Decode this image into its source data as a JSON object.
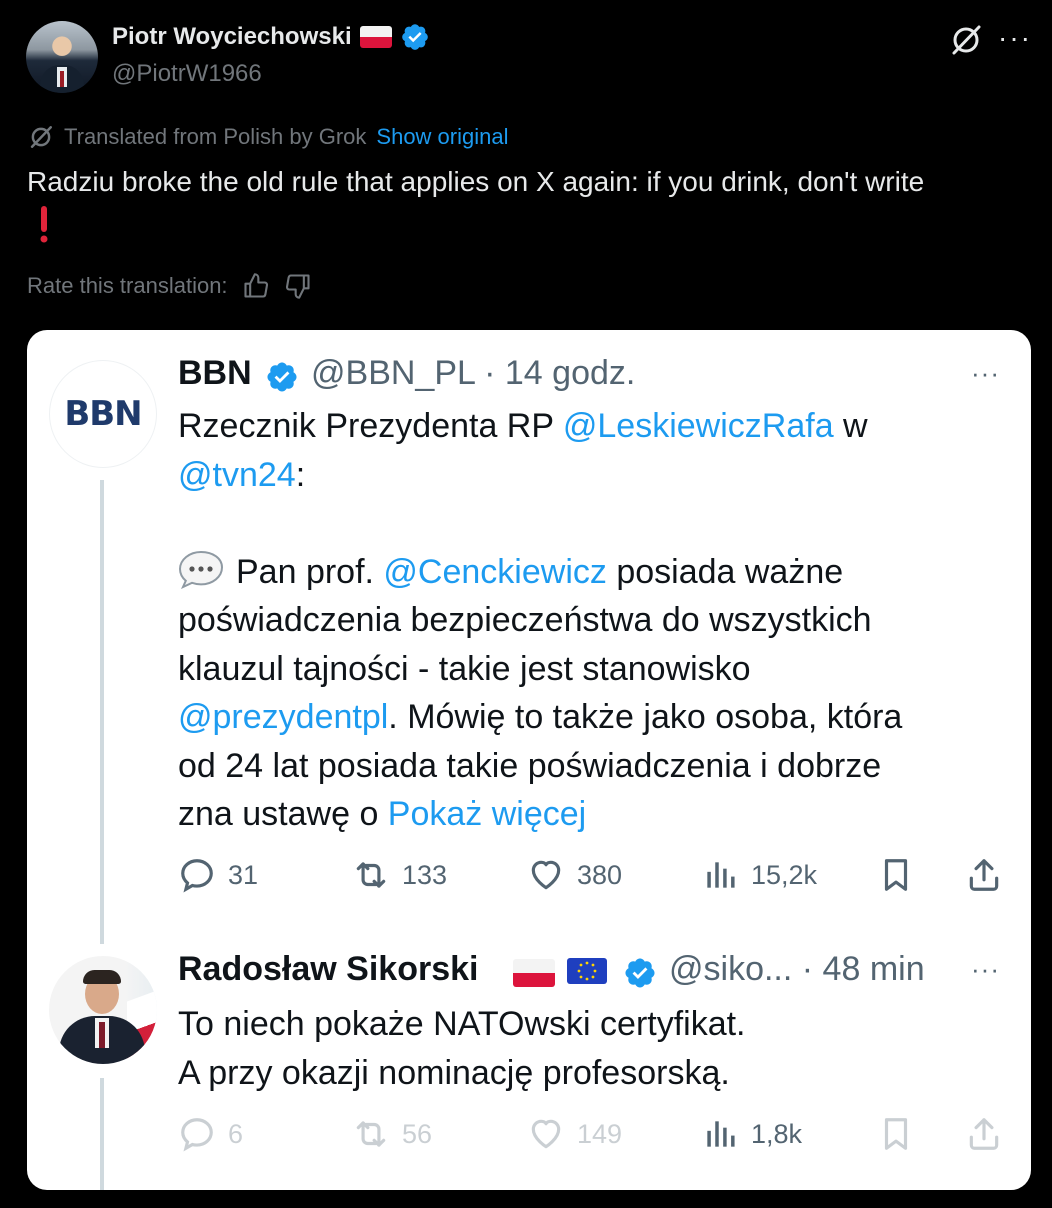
{
  "header": {
    "author_name": "Piotr Woyciechowski",
    "author_handle": "@PiotrW1966",
    "more_label": "···"
  },
  "translation": {
    "notice": "Translated from Polish by Grok",
    "show_original": "Show original"
  },
  "tweet": {
    "text": "Radziu broke the old rule that applies on X again: if you drink, don't write"
  },
  "rate": {
    "label": "Rate this translation:"
  },
  "quoted_thread": {
    "tweet1": {
      "name": "BBN",
      "handle": "@BBN_PL",
      "time": "· 14 godz.",
      "avatar_text": "BBN",
      "line1_pre": "Rzecznik Prezydenta RP ",
      "line1_link": "@LeskiewiczRafa",
      "line1_post": " w",
      "line2_link": "@tvn24",
      "line2_post": ":",
      "p2_pre": "Pan prof. ",
      "p2_link": "@Cenckiewicz",
      "p2_post": " posiada ważne",
      "l4": "poświadczenia bezpieczeństwa do wszystkich",
      "l5": "klauzul tajności - takie jest stanowisko",
      "l6_link": "@prezydentpl",
      "l6_post": ". Mówię to także jako osoba, która",
      "l7": "od 24 lat posiada takie poświadczenia i dobrze",
      "l8_pre": "zna ustawę o ",
      "l8_link": "Pokaż więcej",
      "replies": "31",
      "reposts": "133",
      "likes": "380",
      "views": "15,2k"
    },
    "tweet2": {
      "name": "Radosław Sikorski",
      "handle": "@siko...",
      "time": "· 48 min",
      "l1": "To niech pokaże NATOwski certyfikat.",
      "l2": "A przy okazji nominację profesorską.",
      "replies": "6",
      "reposts": "56",
      "likes": "149",
      "views": "1,8k"
    }
  },
  "colors": {
    "accent": "#1d9bf0",
    "muted": "#71767b",
    "card_bg": "#ffffff"
  }
}
